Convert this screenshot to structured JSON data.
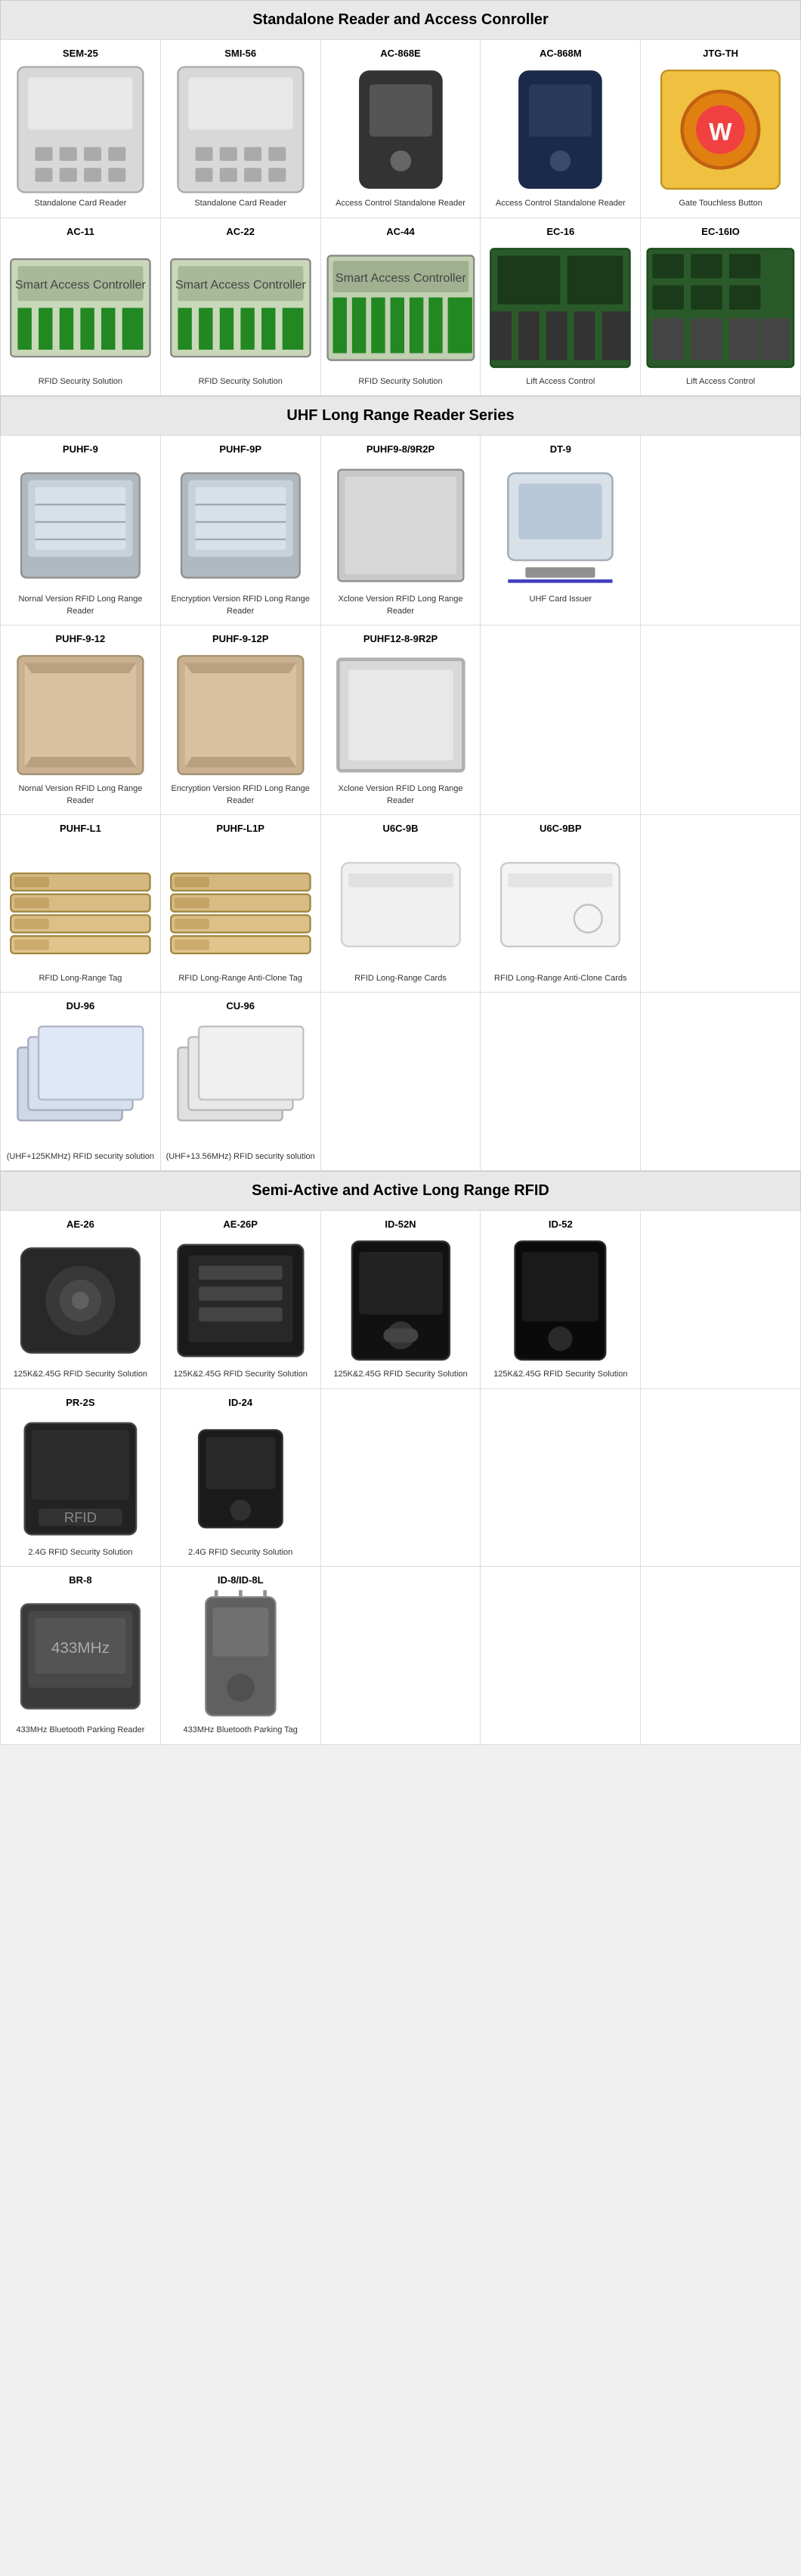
{
  "sections": [
    {
      "id": "standalone",
      "title": "Standalone Reader and Access Conroller",
      "rows": [
        {
          "type": "products",
          "items": [
            {
              "id": "SEM-25",
              "name": "SEM-25",
              "desc": "Standalone Card Reader",
              "imgType": "keypad"
            },
            {
              "id": "SMI-56",
              "name": "SMI-56",
              "desc": "Standalone Card Reader",
              "imgType": "keypad"
            },
            {
              "id": "AC-868E",
              "name": "AC-868E",
              "desc": "Access Control Standalone Reader",
              "imgType": "reader-dark"
            },
            {
              "id": "AC-868M",
              "name": "AC-868M",
              "desc": "Access Control Standalone Reader",
              "imgType": "reader-navy"
            },
            {
              "id": "JTG-TH",
              "name": "JTG-TH",
              "desc": "Gate Touchless Button",
              "imgType": "button-yellow"
            }
          ]
        },
        {
          "type": "products",
          "items": [
            {
              "id": "AC-11",
              "name": "AC-11",
              "desc": "RFID Security Solution",
              "imgType": "controller-green"
            },
            {
              "id": "AC-22",
              "name": "AC-22",
              "desc": "RFID Security Solution",
              "imgType": "controller-green"
            },
            {
              "id": "AC-44",
              "name": "AC-44",
              "desc": "RFID Security Solution",
              "imgType": "controller-green2"
            },
            {
              "id": "EC-16",
              "name": "EC-16",
              "desc": "Lift Access Control",
              "imgType": "controller-pcb"
            },
            {
              "id": "EC-16IO",
              "name": "EC-16IO",
              "desc": "Lift Access Control",
              "imgType": "controller-relay"
            }
          ]
        }
      ]
    },
    {
      "id": "uhf",
      "title": "UHF Long Range Reader Series",
      "rows": [
        {
          "type": "products",
          "items": [
            {
              "id": "PUHF-9",
              "name": "PUHF-9",
              "desc": "Nornal Version RFID Long Range Reader",
              "imgType": "uhf-reader-box"
            },
            {
              "id": "PUHF-9P",
              "name": "PUHF-9P",
              "desc": "Encryption Version RFID Long Range Reader",
              "imgType": "uhf-reader-box"
            },
            {
              "id": "PUHF9-8/9R2P",
              "name": "PUHF9-8/9R2P",
              "desc": "Xclone Version RFID Long Range Reader",
              "imgType": "uhf-panel"
            },
            {
              "id": "DT-9",
              "name": "DT-9",
              "desc": "UHF Card Issuer",
              "imgType": "card-issuer"
            },
            {
              "id": "",
              "name": "",
              "desc": "",
              "imgType": "empty"
            }
          ]
        },
        {
          "type": "products",
          "items": [
            {
              "id": "PUHF-9-12",
              "name": "PUHF-9-12",
              "desc": "Nornal Version RFID Long Range Reader",
              "imgType": "uhf-box-large"
            },
            {
              "id": "PUHF-9-12P",
              "name": "PUHF-9-12P",
              "desc": "Encryption Version RFID Long Range Reader",
              "imgType": "uhf-box-large"
            },
            {
              "id": "PUHF12-8-9R2P",
              "name": "PUHF12-8-9R2P",
              "desc": "Xclone Version RFID Long Range Reader",
              "imgType": "uhf-panel-large"
            },
            {
              "id": "",
              "name": "",
              "desc": "",
              "imgType": "empty"
            },
            {
              "id": "",
              "name": "",
              "desc": "",
              "imgType": "empty"
            }
          ]
        },
        {
          "type": "products",
          "items": [
            {
              "id": "PUHF-L1",
              "name": "PUHF-L1",
              "desc": "RFID Long-Range Tag",
              "imgType": "rfid-tags"
            },
            {
              "id": "PUHF-L1P",
              "name": "PUHF-L1P",
              "desc": "RFID Long-Range Anti-Clone Tag",
              "imgType": "rfid-tags"
            },
            {
              "id": "U6C-9B",
              "name": "U6C-9B",
              "desc": "RFID Long-Range Cards",
              "imgType": "rfid-card-white"
            },
            {
              "id": "U6C-9BP",
              "name": "U6C-9BP",
              "desc": "RFID Long-Range Anti-Clone Cards",
              "imgType": "rfid-card-white2"
            },
            {
              "id": "",
              "name": "",
              "desc": "",
              "imgType": "empty"
            }
          ]
        },
        {
          "type": "products",
          "items": [
            {
              "id": "DU-96",
              "name": "DU-96",
              "desc": "(UHF+125KMHz) RFID security solution",
              "imgType": "rfid-cards-stack"
            },
            {
              "id": "CU-96",
              "name": "CU-96",
              "desc": "(UHF+13.56MHz) RFID security solution",
              "imgType": "rfid-cards-stack2"
            },
            {
              "id": "",
              "name": "",
              "desc": "",
              "imgType": "empty"
            },
            {
              "id": "",
              "name": "",
              "desc": "",
              "imgType": "empty"
            },
            {
              "id": "",
              "name": "",
              "desc": "",
              "imgType": "empty"
            }
          ]
        }
      ]
    },
    {
      "id": "semi-active",
      "title": "Semi-Active and Active Long Range RFID",
      "rows": [
        {
          "type": "products",
          "items": [
            {
              "id": "AE-26",
              "name": "AE-26",
              "desc": "125K&2.45G RFID Security Solution",
              "imgType": "active-reader-round"
            },
            {
              "id": "AE-26P",
              "name": "AE-26P",
              "desc": "125K&2.45G RFID Security Solution",
              "imgType": "active-reader-box"
            },
            {
              "id": "ID-52N",
              "name": "ID-52N",
              "desc": "125K&2.45G RFID Security Solution",
              "imgType": "active-reader-black"
            },
            {
              "id": "ID-52",
              "name": "ID-52",
              "desc": "125K&2.45G RFID Security Solution",
              "imgType": "active-reader-dark"
            },
            {
              "id": "",
              "name": "",
              "desc": "",
              "imgType": "empty"
            }
          ]
        },
        {
          "type": "products",
          "items": [
            {
              "id": "PR-2S",
              "name": "PR-2S",
              "desc": "2.4G RFID Security Solution",
              "imgType": "reader-2g"
            },
            {
              "id": "ID-24",
              "name": "ID-24",
              "desc": "2.4G RFID Security Solution",
              "imgType": "reader-2g-small"
            },
            {
              "id": "",
              "name": "",
              "desc": "",
              "imgType": "empty"
            },
            {
              "id": "",
              "name": "",
              "desc": "",
              "imgType": "empty"
            },
            {
              "id": "",
              "name": "",
              "desc": "",
              "imgType": "empty"
            }
          ]
        },
        {
          "type": "products",
          "items": [
            {
              "id": "BR-8",
              "name": "BR-8",
              "desc": "433MHz Bluetooth Parking Reader",
              "imgType": "reader-433"
            },
            {
              "id": "ID-8/ID-8L",
              "name": "ID-8/ID-8L",
              "desc": "433MHz Bluetooth Parking Tag",
              "imgType": "tag-433"
            },
            {
              "id": "",
              "name": "",
              "desc": "",
              "imgType": "empty"
            },
            {
              "id": "",
              "name": "",
              "desc": "",
              "imgType": "empty"
            },
            {
              "id": "",
              "name": "",
              "desc": "",
              "imgType": "empty"
            }
          ]
        }
      ]
    }
  ]
}
